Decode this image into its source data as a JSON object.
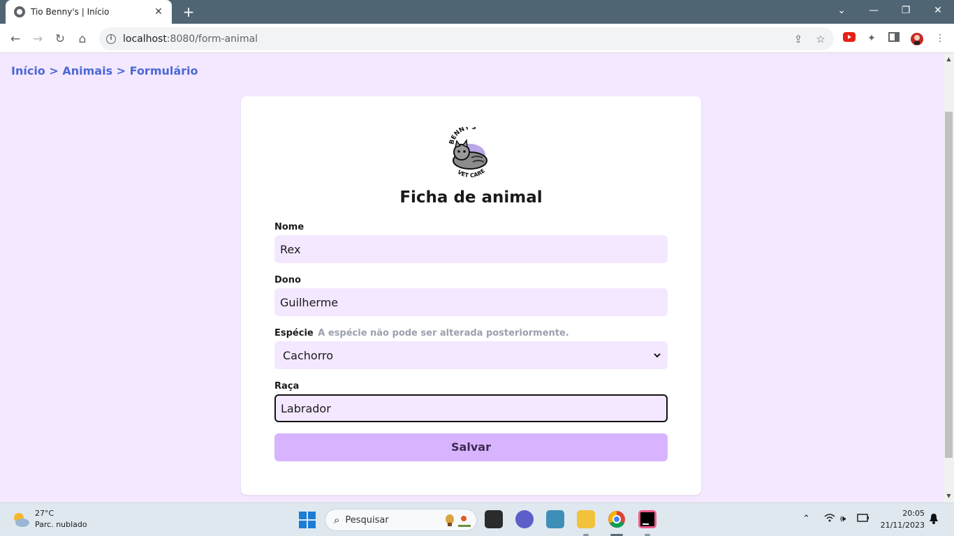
{
  "browser": {
    "tab_title": "Tio Benny's | Início",
    "tab_close": "✕",
    "new_tab": "+",
    "url_host": "localhost",
    "url_path": ":8080/form-animal"
  },
  "page": {
    "breadcrumb": [
      "Início",
      "Animais",
      "Formulário"
    ],
    "breadcrumb_sep": ">",
    "logo_text_top": "BENNY'S",
    "logo_text_bottom": "VET CARE",
    "form_title": "Ficha de animal",
    "fields": {
      "nome": {
        "label": "Nome",
        "value": "Rex"
      },
      "dono": {
        "label": "Dono",
        "value": "Guilherme"
      },
      "especie": {
        "label": "Espécie",
        "hint": "A espécie não pode ser alterada posteriormente.",
        "value": "Cachorro"
      },
      "raca": {
        "label": "Raça",
        "value": "Labrador"
      }
    },
    "save_label": "Salvar"
  },
  "taskbar": {
    "temperature": "27°C",
    "weather_desc": "Parc. nublado",
    "search_placeholder": "Pesquisar",
    "time": "20:05",
    "date": "21/11/2023"
  },
  "colors": {
    "page_bg": "#f3e8ff",
    "breadcrumb": "#4c67d4",
    "button_bg": "#d8b4fe",
    "tab_bar": "#4f6574"
  }
}
